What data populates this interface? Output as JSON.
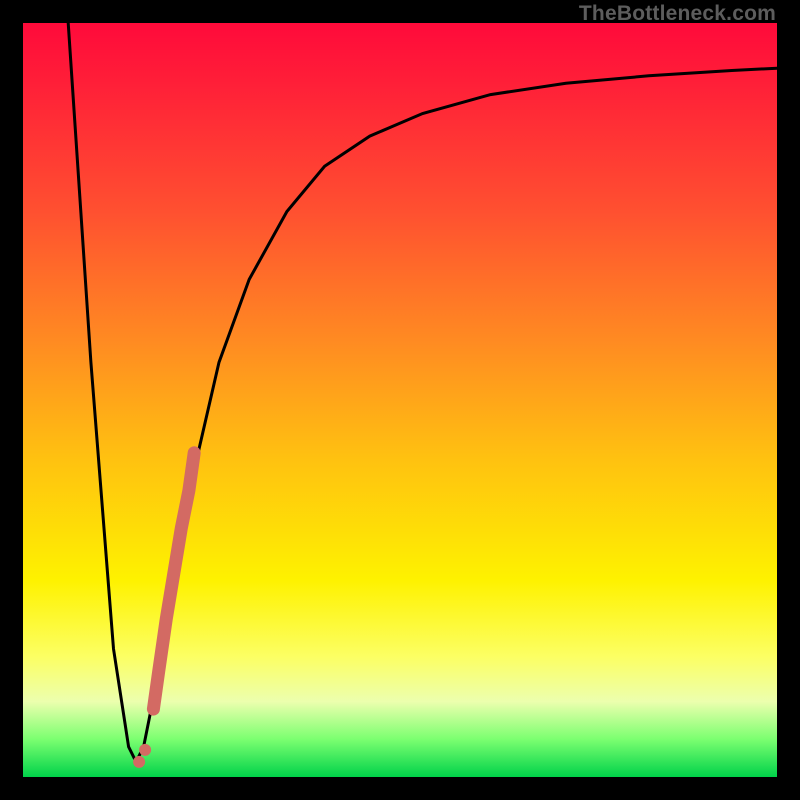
{
  "watermark": "TheBottleneck.com",
  "chart_data": {
    "type": "line",
    "title": "",
    "xlabel": "",
    "ylabel": "",
    "xlim": [
      0,
      100
    ],
    "ylim": [
      0,
      100
    ],
    "grid": false,
    "series": [
      {
        "name": "curve",
        "x": [
          6,
          9,
          12,
          14,
          15,
          16,
          18,
          20,
          23,
          26,
          30,
          35,
          40,
          46,
          53,
          62,
          72,
          83,
          94,
          100
        ],
        "y": [
          100,
          55,
          17,
          4,
          2,
          4,
          14,
          26,
          42,
          55,
          66,
          75,
          81,
          85,
          88,
          90.5,
          92,
          93,
          93.7,
          94
        ]
      }
    ],
    "highlight_segment": {
      "name": "emphasized",
      "color_hex": "#d36a63",
      "x": [
        17.3,
        18,
        19,
        20,
        21,
        22,
        22.7
      ],
      "y": [
        9,
        14,
        21,
        27,
        33,
        38,
        43
      ]
    },
    "highlight_points": {
      "name": "dots",
      "color_hex": "#d36a63",
      "x": [
        15.4,
        16.2
      ],
      "y": [
        2.0,
        3.6
      ]
    },
    "colors": {
      "gradient_top": "#ff0a3a",
      "gradient_mid1": "#ff8a22",
      "gradient_mid2": "#fef200",
      "gradient_bottom": "#00d24a",
      "curve": "#000000",
      "frame": "#000000"
    }
  }
}
